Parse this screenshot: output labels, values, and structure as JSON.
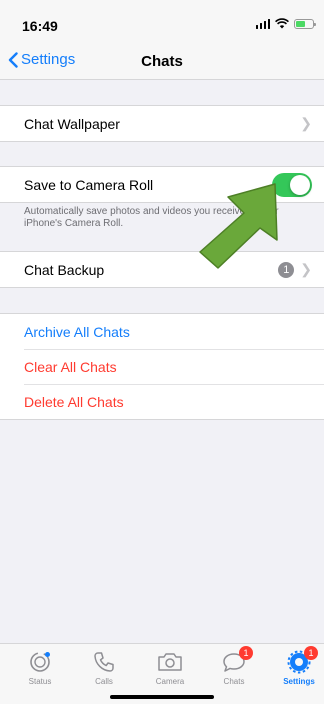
{
  "status": {
    "time": "16:49"
  },
  "nav": {
    "back_label": "Settings",
    "title": "Chats"
  },
  "rows": {
    "wallpaper": "Chat Wallpaper",
    "save_camera_roll": "Save to Camera Roll",
    "save_camera_roll_enabled": true,
    "save_description": "Automatically save photos and videos you receive to your iPhone's Camera Roll.",
    "backup": "Chat Backup",
    "backup_badge": "1",
    "archive_all": "Archive All Chats",
    "clear_all": "Clear All Chats",
    "delete_all": "Delete All Chats"
  },
  "tabs": [
    {
      "label": "Status",
      "icon": "status-icon",
      "badge": ""
    },
    {
      "label": "Calls",
      "icon": "phone-icon",
      "badge": ""
    },
    {
      "label": "Camera",
      "icon": "camera-icon",
      "badge": ""
    },
    {
      "label": "Chats",
      "icon": "chat-bubble-icon",
      "badge": "1"
    },
    {
      "label": "Settings",
      "icon": "gear-icon",
      "badge": "1"
    }
  ],
  "colors": {
    "accent": "#147efb",
    "destructive": "#ff3b30",
    "toggle_on": "#34c759",
    "annotation_arrow": "#6aa83a"
  }
}
